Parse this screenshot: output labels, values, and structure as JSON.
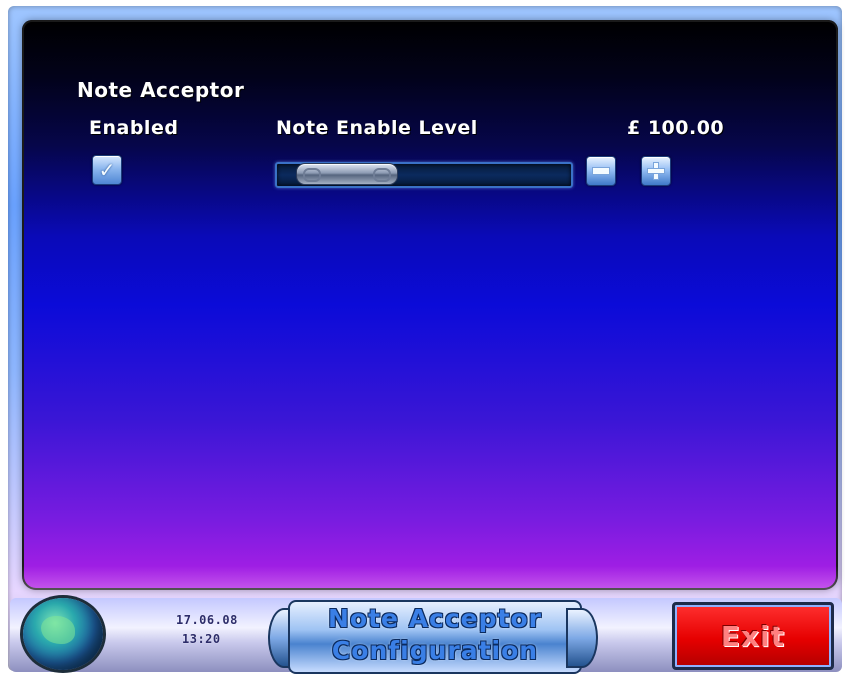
{
  "screen": {
    "section_title": "Note Acceptor",
    "enabled_label": "Enabled",
    "level_label": "Note Enable Level",
    "amount": "£ 100.00",
    "enabled_checked": true,
    "slider_level": 0.4
  },
  "footer": {
    "date": "17.06.08",
    "time": "13:20",
    "title_line1": "Note Acceptor",
    "title_line2": "Configuration",
    "exit_label": "Exit"
  },
  "icons": {
    "checkbox": "check-icon",
    "decrease": "minus-icon",
    "increase": "plus-icon",
    "logo": "globe-icon"
  },
  "colors": {
    "exit_button": "#e60000",
    "screen_top": "#000000",
    "screen_bottom": "#b21fe6"
  }
}
